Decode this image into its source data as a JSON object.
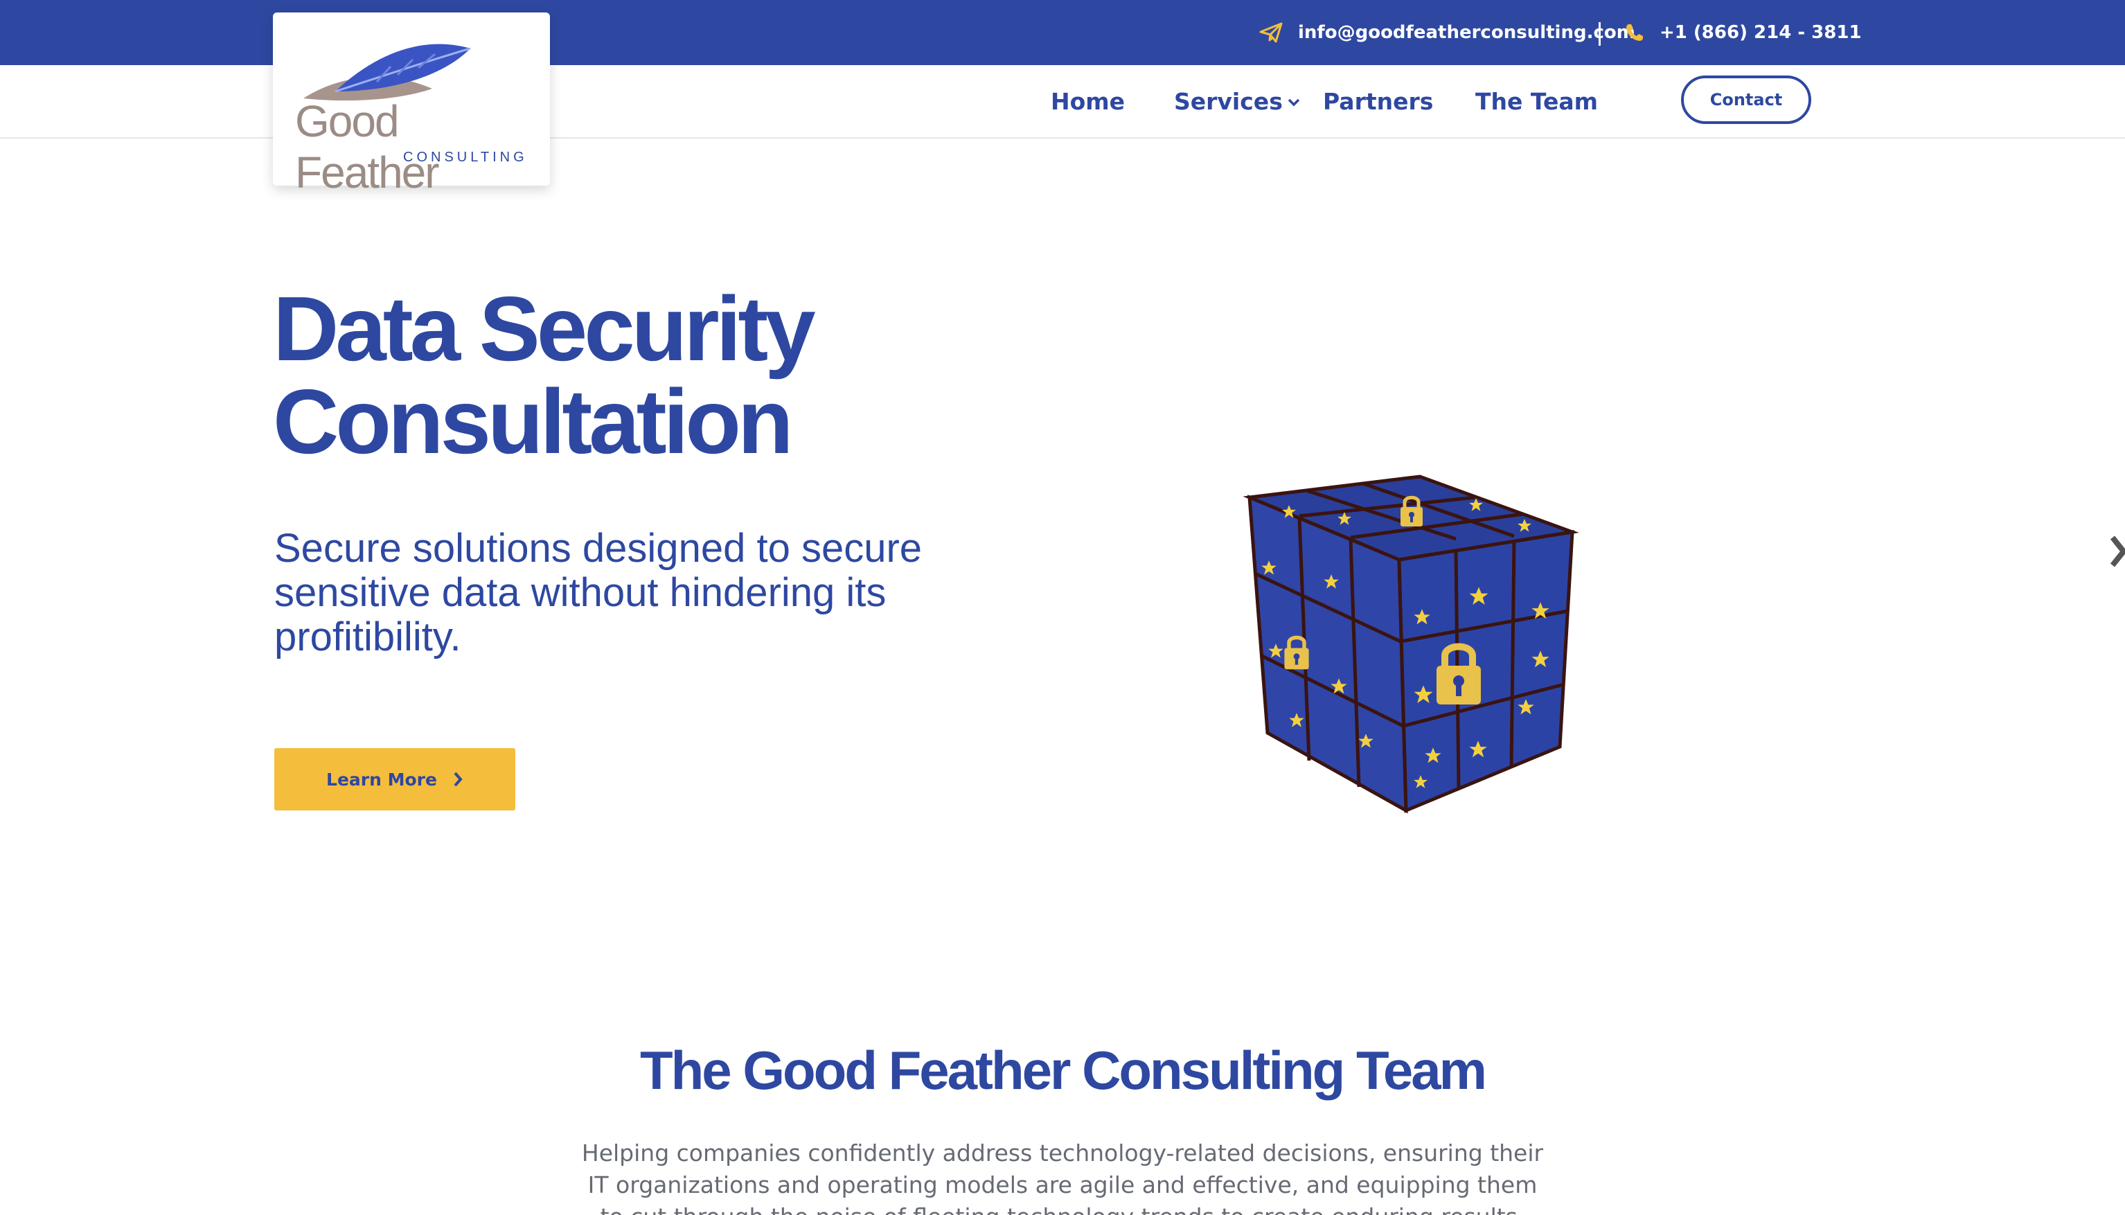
{
  "colors": {
    "brand_blue": "#2e48a1",
    "accent_yellow": "#f4bd3c",
    "body_gray": "#666a73",
    "logo_taupe": "#9b8c85"
  },
  "topbar": {
    "email": "info@goodfeatherconsulting.com",
    "email_icon": "paper-plane-icon",
    "phone": "+1 (866) 214 - 3811",
    "phone_icon": "phone-icon"
  },
  "logo": {
    "name": "Good Feather",
    "tagline": "CONSULTING"
  },
  "nav": {
    "home": "Home",
    "services": "Services",
    "partners": "Partners",
    "team": "The Team",
    "contact": "Contact"
  },
  "hero": {
    "title_line1": "Data Security",
    "title_line2": "Consultation",
    "subtitle": "Secure solutions designed to secure sensitive data without hindering its profitibility.",
    "cta": "Learn More",
    "image_icon": "padlock-cube-icon"
  },
  "team": {
    "title": "The Good Feather Consulting Team",
    "text": "Helping companies confidently address technology-related decisions, ensuring their IT organizations and operating models are agile and effective, and equipping them to cut through the noise of fleeting technology trends to create enduring results."
  }
}
